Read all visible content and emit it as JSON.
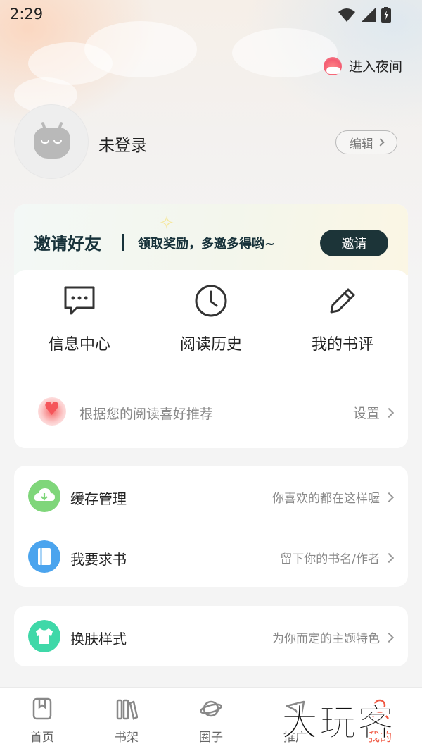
{
  "status_bar": {
    "time": "2:29"
  },
  "header": {
    "night_mode_label": "进入夜间"
  },
  "profile": {
    "username": "未登录",
    "edit_label": "编辑"
  },
  "invite": {
    "title": "邀请好友",
    "subtitle": "领取奖励，多邀多得哟~",
    "button": "邀请"
  },
  "quick_actions": [
    {
      "label": "信息中心",
      "icon": "message-icon"
    },
    {
      "label": "阅读历史",
      "icon": "clock-icon"
    },
    {
      "label": "我的书评",
      "icon": "pen-icon"
    }
  ],
  "recommend": {
    "text": "根据您的阅读喜好推荐",
    "settings_label": "设置"
  },
  "list_items": [
    {
      "label": "缓存管理",
      "hint": "你喜欢的都在这样喔",
      "icon": "cloud-download-icon",
      "color": "#7fd67a"
    },
    {
      "label": "我要求书",
      "hint": "留下你的书名/作者",
      "icon": "book-icon",
      "color": "#4ba4ee"
    },
    {
      "label": "换肤样式",
      "hint": "为你而定的主题特色",
      "icon": "shirt-icon",
      "color": "#3fd8a8"
    }
  ],
  "tabs": [
    {
      "label": "首页",
      "icon": "bookmark-icon"
    },
    {
      "label": "书架",
      "icon": "bookshelf-icon"
    },
    {
      "label": "圈子",
      "icon": "planet-icon"
    },
    {
      "label": "推广",
      "icon": "promote-icon"
    },
    {
      "label": "我的",
      "icon": "profile-icon",
      "active": true
    }
  ],
  "watermark": "大玩客",
  "colors": {
    "accent": "#f05a45",
    "invite_button": "#1c3438"
  }
}
